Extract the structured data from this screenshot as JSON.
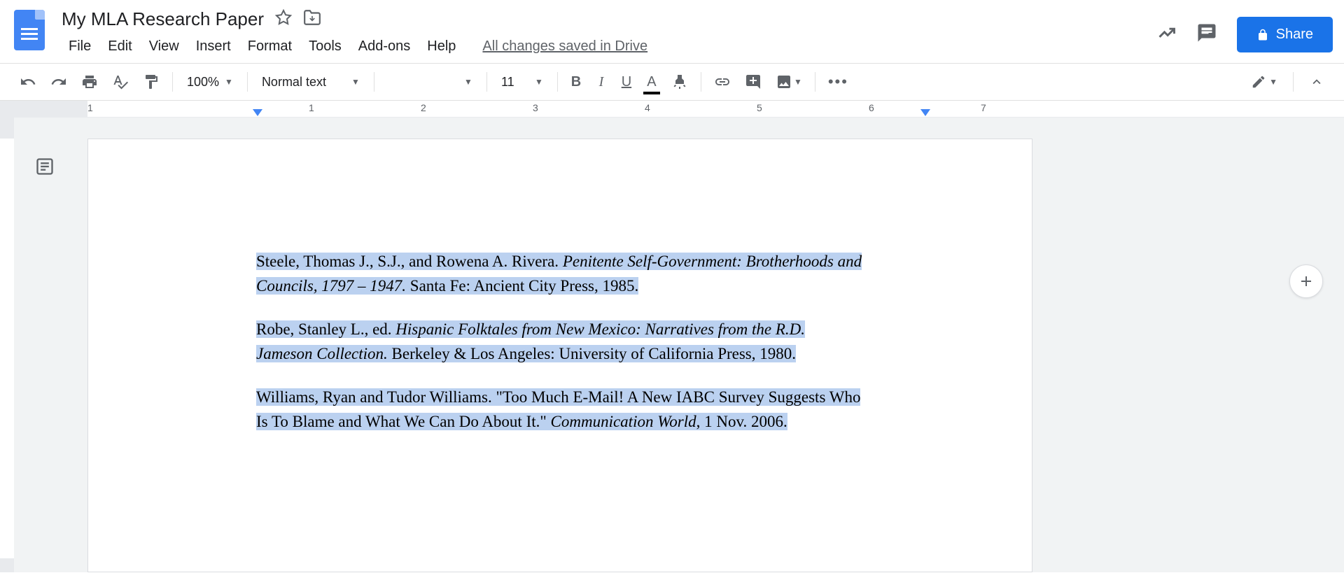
{
  "header": {
    "title": "My MLA Research Paper",
    "menu": [
      "File",
      "Edit",
      "View",
      "Insert",
      "Format",
      "Tools",
      "Add-ons",
      "Help"
    ],
    "save_status": "All changes saved in Drive",
    "share_label": "Share"
  },
  "toolbar": {
    "zoom": "100%",
    "style": "Normal text",
    "font": "",
    "font_size": "11"
  },
  "ruler": {
    "numbers": [
      "1",
      "1",
      "2",
      "3",
      "4",
      "5",
      "6",
      "7"
    ]
  },
  "document": {
    "citations": [
      {
        "author": "Steele, Thomas J., S.J., and Rowena A. Rivera. ",
        "title": "Penitente Self-Government: Brotherhoods and Councils, 1797 – 1947.",
        "publication": " Santa Fe: Ancient City Press, 1985."
      },
      {
        "author": "Robe, Stanley L., ed. ",
        "title": "Hispanic Folktales from New Mexico: Narratives from the R.D. Jameson Collection.",
        "publication": " Berkeley & Los Angeles: University of California Press, 1980."
      },
      {
        "author": "Williams, Ryan and Tudor Williams. \"Too Much E-Mail! A New IABC Survey Suggests Who Is To Blame and What We Can Do About It.\" ",
        "title": "Communication World",
        "publication": ", 1 Nov. 2006."
      }
    ]
  }
}
